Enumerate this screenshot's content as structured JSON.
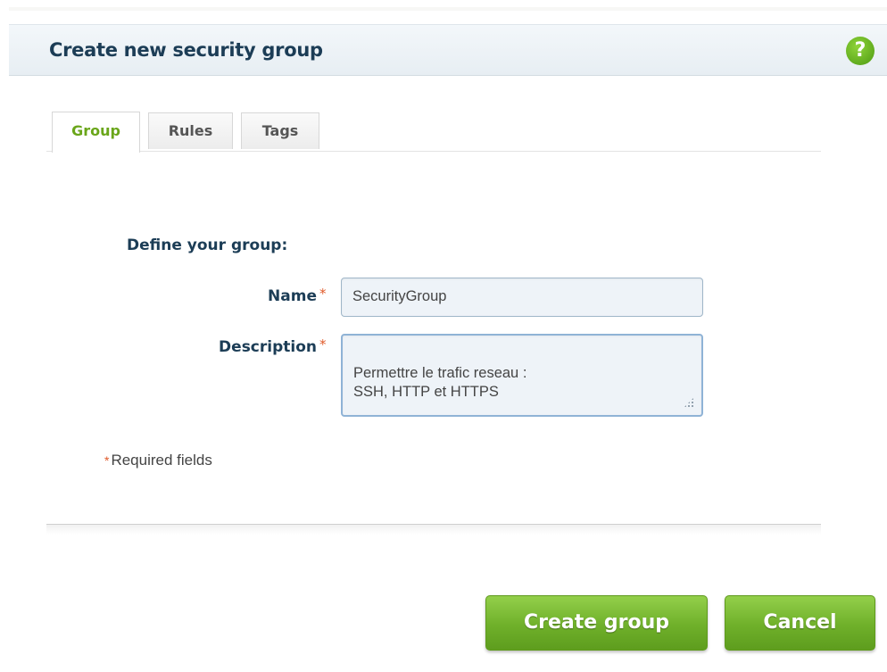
{
  "dialog": {
    "title": "Create new security group",
    "help_icon": "question-circle-icon"
  },
  "tabs": [
    {
      "label": "Group",
      "active": true
    },
    {
      "label": "Rules",
      "active": false
    },
    {
      "label": "Tags",
      "active": false
    }
  ],
  "form": {
    "section_title": "Define your group:",
    "name_label": "Name",
    "name_value": "SecurityGroup",
    "description_label": "Description",
    "description_value": "Permettre le trafic reseau :\nSSH, HTTP et HTTPS",
    "required_star": "*",
    "required_note": "Required fields"
  },
  "buttons": {
    "create_label": "Create group",
    "cancel_label": "Cancel"
  },
  "colors": {
    "accent_green": "#6fb02a",
    "title_navy": "#1c3d56",
    "required_orange": "#e05a2a"
  }
}
